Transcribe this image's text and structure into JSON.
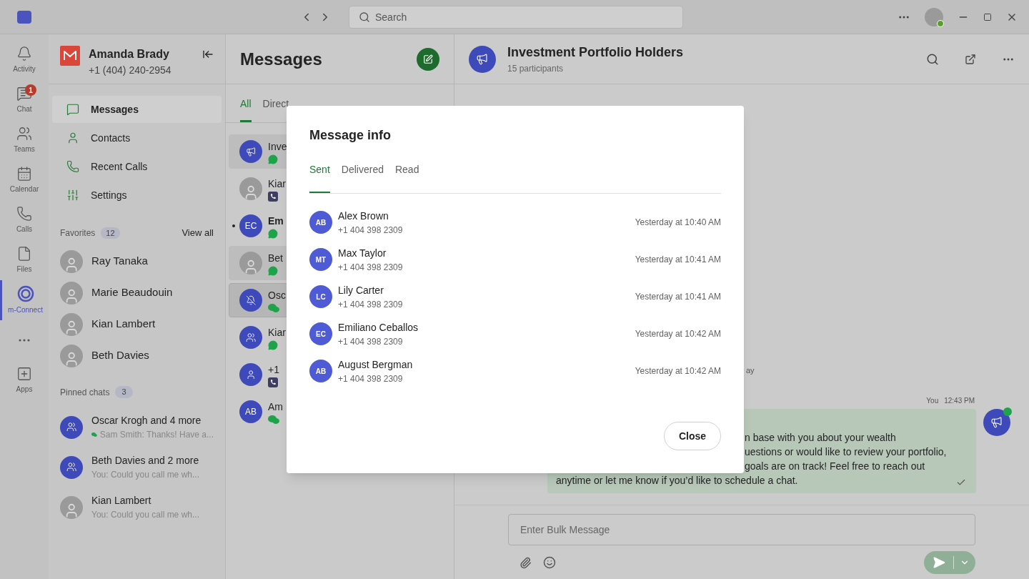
{
  "title_bar": {
    "search": {
      "placeholder": "Search"
    }
  },
  "rail": [
    {
      "kind": "activity",
      "label": "Activity",
      "selected": false
    },
    {
      "kind": "chat",
      "label": "Chat",
      "selected": false,
      "badge": "1"
    },
    {
      "kind": "teams",
      "label": "Teams",
      "selected": false
    },
    {
      "kind": "calendar",
      "label": "Calendar",
      "selected": false
    },
    {
      "kind": "calls",
      "label": "Calls",
      "selected": false
    },
    {
      "kind": "files",
      "label": "Files",
      "selected": false
    },
    {
      "kind": "connect",
      "label": "m-Connect",
      "selected": true
    },
    {
      "kind": "more",
      "selected": false
    },
    {
      "kind": "apps",
      "label": "Apps",
      "selected": false
    }
  ],
  "account": {
    "name": "Amanda Brady",
    "phone": "+1 (404) 240-2954"
  },
  "nav": [
    {
      "kind": "messages",
      "label": "Messages",
      "selected": true
    },
    {
      "kind": "contacts",
      "label": "Contacts",
      "selected": false
    },
    {
      "kind": "calls",
      "label": "Recent Calls",
      "selected": false
    },
    {
      "kind": "settings",
      "label": "Settings",
      "selected": false
    }
  ],
  "favorites": {
    "title": "Favorites",
    "count": "12",
    "action": "View all",
    "people": [
      {
        "name": "Ray Tanaka"
      },
      {
        "name": "Marie Beaudouin"
      },
      {
        "name": "Kian Lambert"
      },
      {
        "name": "Beth Davies"
      }
    ]
  },
  "pinned": {
    "title": "Pinned chats",
    "count": "3",
    "chats": [
      {
        "kind": "group",
        "name": "Oscar Krogh and 4 more",
        "preview": "Sam Smith: Thanks! Have a...",
        "channel": {
          "kind": "wechat"
        }
      },
      {
        "kind": "group",
        "name": "Beth Davies and 2 more",
        "preview": "You: Could you call me wh..."
      },
      {
        "kind": "photo",
        "name": "Kian Lambert",
        "preview": "You: Could you call me wh..."
      }
    ]
  },
  "messages": {
    "title": "Messages",
    "tabs": [
      {
        "label": "All",
        "selected": true
      },
      {
        "label": "Direct",
        "selected": false
      }
    ],
    "conversations": [
      {
        "kind": "broadcast",
        "name": "Inve",
        "channel": {
          "kind": "whatsapp"
        },
        "selected": false,
        "highlighted": true,
        "unread": false
      },
      {
        "kind": "photo",
        "name": "Kiar",
        "channel": {
          "kind": "phone"
        },
        "selected": false,
        "highlighted": false,
        "unread": false
      },
      {
        "kind": "initials",
        "initials": "EC",
        "name": "Em",
        "channel": {
          "kind": "whatsapp"
        },
        "selected": false,
        "highlighted": false,
        "unread": true
      },
      {
        "kind": "photo",
        "name": "Bet",
        "channel": {
          "kind": "whatsapp"
        },
        "selected": false,
        "highlighted": true,
        "unread": false
      },
      {
        "kind": "muted",
        "name": "Osc",
        "channel": {
          "kind": "wechat"
        },
        "selected": true,
        "highlighted": false,
        "unread": false
      },
      {
        "kind": "group",
        "name": "Kiar",
        "channel": {
          "kind": "whatsapp"
        },
        "selected": false,
        "highlighted": false,
        "unread": false
      },
      {
        "kind": "person",
        "name": "+1",
        "channel": {
          "kind": "phone"
        },
        "selected": false,
        "highlighted": false,
        "unread": false
      },
      {
        "kind": "initials",
        "initials": "AB",
        "name": "Am",
        "channel": {
          "kind": "wechat"
        },
        "selected": false,
        "highlighted": false,
        "unread": false
      }
    ]
  },
  "chat": {
    "title": "Investment Portfolio Holders",
    "subtitle": "15 participants",
    "divider_fragment": "ay",
    "message": {
      "sender": "You",
      "time": "12:43 PM",
      "lines": [
        "n base with you about your wealth",
        "uestions or would like to review your portfolio,",
        "goals are on track! Feel free to reach out",
        "anytime or let me know if you’d like to schedule a chat."
      ],
      "delivered": true
    },
    "composer": {
      "placeholder": "Enter Bulk Message"
    }
  },
  "dialog": {
    "title": "Message info",
    "tabs": [
      {
        "label": "Sent",
        "selected": true
      },
      {
        "label": "Delivered",
        "selected": false
      },
      {
        "label": "Read",
        "selected": false
      }
    ],
    "recipients": [
      {
        "initials": "AB",
        "name": "Alex Brown",
        "phone": "+1 404 398 2309",
        "time": "Yesterday at 10:40 AM"
      },
      {
        "initials": "MT",
        "name": "Max Taylor",
        "phone": "+1 404 398 2309",
        "time": "Yesterday at 10:41 AM"
      },
      {
        "initials": "LC",
        "name": "Lily Carter",
        "phone": "+1 404 398 2309",
        "time": "Yesterday at 10:41 AM"
      },
      {
        "initials": "EC",
        "name": "Emiliano Ceballos",
        "phone": "+1 404 398 2309",
        "time": "Yesterday at 10:42 AM"
      },
      {
        "initials": "AB",
        "name": "August Bergman",
        "phone": "+1 404 398 2309",
        "time": "Yesterday at 10:42 AM"
      }
    ],
    "close": "Close"
  }
}
